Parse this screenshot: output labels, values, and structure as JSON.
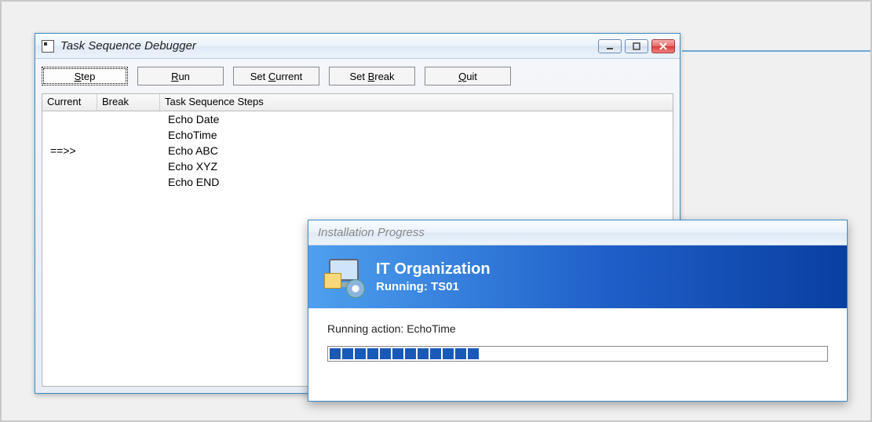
{
  "debugger": {
    "title": "Task Sequence Debugger",
    "toolbar": {
      "step_label": "Step",
      "step_accel": "S",
      "run_label": "Run",
      "run_accel": "R",
      "setcurrent_label": "Set Current",
      "setcurrent_accel": "C",
      "setbreak_label": "Set Break",
      "setbreak_accel": "B",
      "quit_label": "Quit",
      "quit_accel": "Q"
    },
    "columns": {
      "current": "Current",
      "break": "Break",
      "steps": "Task Sequence Steps"
    },
    "current_marker": "==>>",
    "rows": [
      {
        "current": "",
        "break": "",
        "step": "Echo Date"
      },
      {
        "current": "",
        "break": "",
        "step": "EchoTime"
      },
      {
        "current": "==>>",
        "break": "",
        "step": "Echo ABC"
      },
      {
        "current": "",
        "break": "",
        "step": "Echo XYZ"
      },
      {
        "current": "",
        "break": "",
        "step": "Echo END"
      }
    ]
  },
  "progress": {
    "title": "Installation Progress",
    "org": "IT Organization",
    "running_prefix": "Running:",
    "running_name": "TS01",
    "action_prefix": "Running action:",
    "action_name": "EchoTime",
    "segments_filled": 12,
    "segments_total": 40
  }
}
